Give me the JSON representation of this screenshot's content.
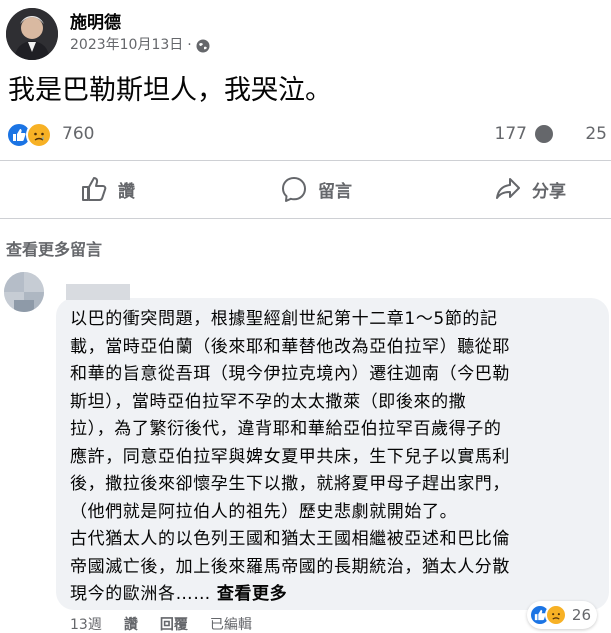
{
  "post": {
    "author": "施明德",
    "date": "2023年10月13日",
    "separator": "·",
    "text": "我是巴勒斯坦人，我哭泣。",
    "reactions_count": "760",
    "comments_count": "177",
    "shares_count": "25"
  },
  "actions": {
    "like": "讚",
    "comment": "留言",
    "share": "分享"
  },
  "more_comments": "查看更多留言",
  "comment": {
    "author_blurred": true,
    "text_lines": [
      "以巴的衝突問題，根據聖經創世紀第十二章1～5節的記",
      "載，當時亞伯蘭（後來耶和華替他改為亞伯拉罕）聽從耶",
      "和華的旨意從吾珥（現今伊拉克境內）遷往迦南（今巴勒",
      "斯坦），當時亞伯拉罕不孕的太太撒萊（即後來的撒",
      "拉），為了繁衍後代，違背耶和華給亞伯拉罕百歲得子的",
      "應許，同意亞伯拉罕與婢女夏甲共床，生下兒子以實馬利",
      "後，撒拉後來卻懷孕生下以撒，就將夏甲母子趕出家門，",
      "（他們就是阿拉伯人的祖先）歷史悲劇就開始了。",
      "古代猶太人的以色列王國和猶太王國相繼被亞述和巴比倫",
      "帝國滅亡後，加上後來羅馬帝國的長期統治，猶太人分散",
      "現今的歐洲各……"
    ],
    "see_more": "查看更多",
    "reaction_count": "26",
    "time": "13週",
    "like": "讚",
    "reply": "回覆",
    "edited": "已編輯"
  },
  "colors": {
    "like_blue": "#1b74e4",
    "sad_yellow": "#f7b125",
    "secondary_text": "#65676b",
    "bubble_bg": "#f0f2f5"
  },
  "icons": [
    "avatar",
    "globe-icon",
    "like-reaction-icon",
    "sad-reaction-icon",
    "comment-bubble-icon",
    "thumbs-up-icon",
    "comment-icon",
    "share-icon"
  ]
}
